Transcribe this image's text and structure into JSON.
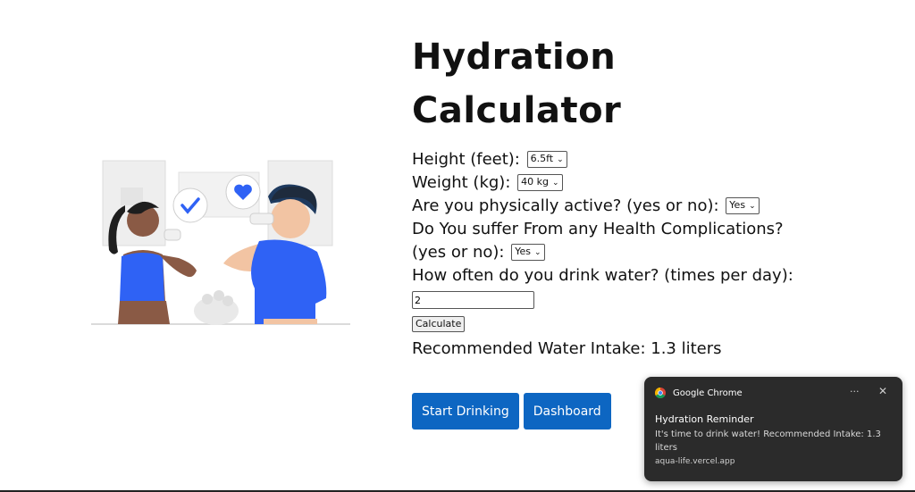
{
  "page": {
    "title": "Hydration Calculator"
  },
  "form": {
    "height_label": "Height (feet):",
    "height_value": "6.5ft",
    "weight_label": "Weight (kg):",
    "weight_value": "40 kg",
    "active_label": "Are you physically active? (yes or no):",
    "active_value": "Yes",
    "health_label_1": "Do You suffer From any Health Complications?",
    "health_label_2": "(yes or no):",
    "health_value": "Yes",
    "frequency_label": "How often do you drink water? (times per day):",
    "frequency_value": "2",
    "calculate_label": "Calculate",
    "result_text": "Recommended Water Intake: 1.3 liters"
  },
  "actions": {
    "start_label": "Start Drinking",
    "dashboard_label": "Dashboard"
  },
  "notification": {
    "app_name": "Google Chrome",
    "more": "···",
    "close": "✕",
    "title": "Hydration Reminder",
    "body": "It's time to drink water! Recommended Intake: 1.3 liters",
    "origin": "aqua-life.vercel.app"
  },
  "colors": {
    "primary": "#0d66c2",
    "illustration_blue": "#2f62f5",
    "toast_bg": "#2b2b2b"
  }
}
